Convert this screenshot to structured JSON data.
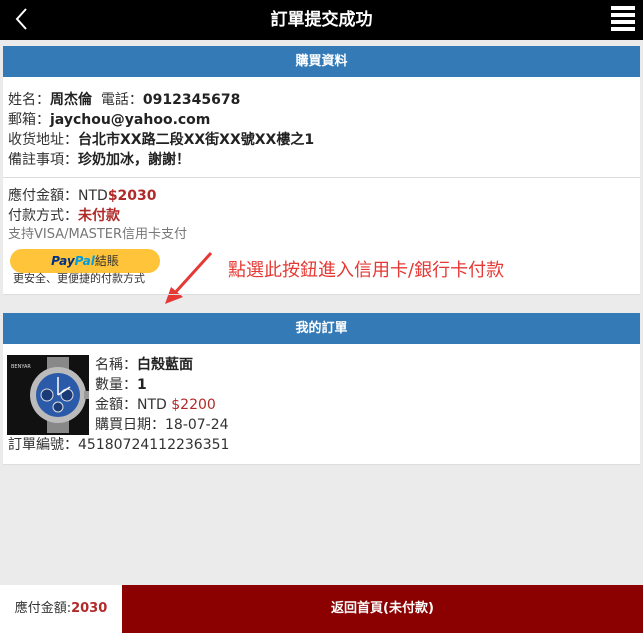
{
  "header": {
    "title": "訂單提交成功",
    "back_icon": "chevron-left-icon",
    "menu_icon": "list-menu-icon"
  },
  "purchase": {
    "title": "購買資料",
    "name_label": "姓名：",
    "name": "周杰倫",
    "phone_label": "電話：",
    "phone": "0912345678",
    "email_label": "郵箱：",
    "email": "jaychou@yahoo.com",
    "address_label": "收货地址：",
    "address": "台北市XX路二段XX街XX號XX樓之1",
    "note_label": "備註事項：",
    "note": "珍奶加冰，謝謝！",
    "amount_label": "應付金額：",
    "amount_prefix": "NTD",
    "amount": "$2030",
    "payment_label": "付款方式：",
    "payment_status": "未付款",
    "support_text": "支持VISA/MASTER信用卡支付",
    "paypal_pay": "Pay",
    "paypal_pal": "Pal",
    "paypal_suffix": "結賬",
    "paypal_sub": "更安全、更便捷的付款方式",
    "annotation": "點選此按鈕進入信用卡/銀行卡付款"
  },
  "order": {
    "title": "我的訂單",
    "brand": "BENYAR",
    "name_label": "名稱：",
    "name": "白殼藍面",
    "qty_label": "數量：",
    "qty": "1",
    "price_label": "金額：",
    "price_prefix": "NTD ",
    "price": "$2200",
    "date_label": "購買日期：",
    "date": "18-07-24",
    "order_no_label": "訂單編號：",
    "order_no": "45180724112236351"
  },
  "footer": {
    "total_label": "應付金額:",
    "total": "2030",
    "home_button": "返回首頁(未付款)"
  },
  "colors": {
    "accent_blue": "#337ab7",
    "price_red": "#b12a2a",
    "footer_red": "#8b0000",
    "paypal_yellow": "#ffc439"
  }
}
